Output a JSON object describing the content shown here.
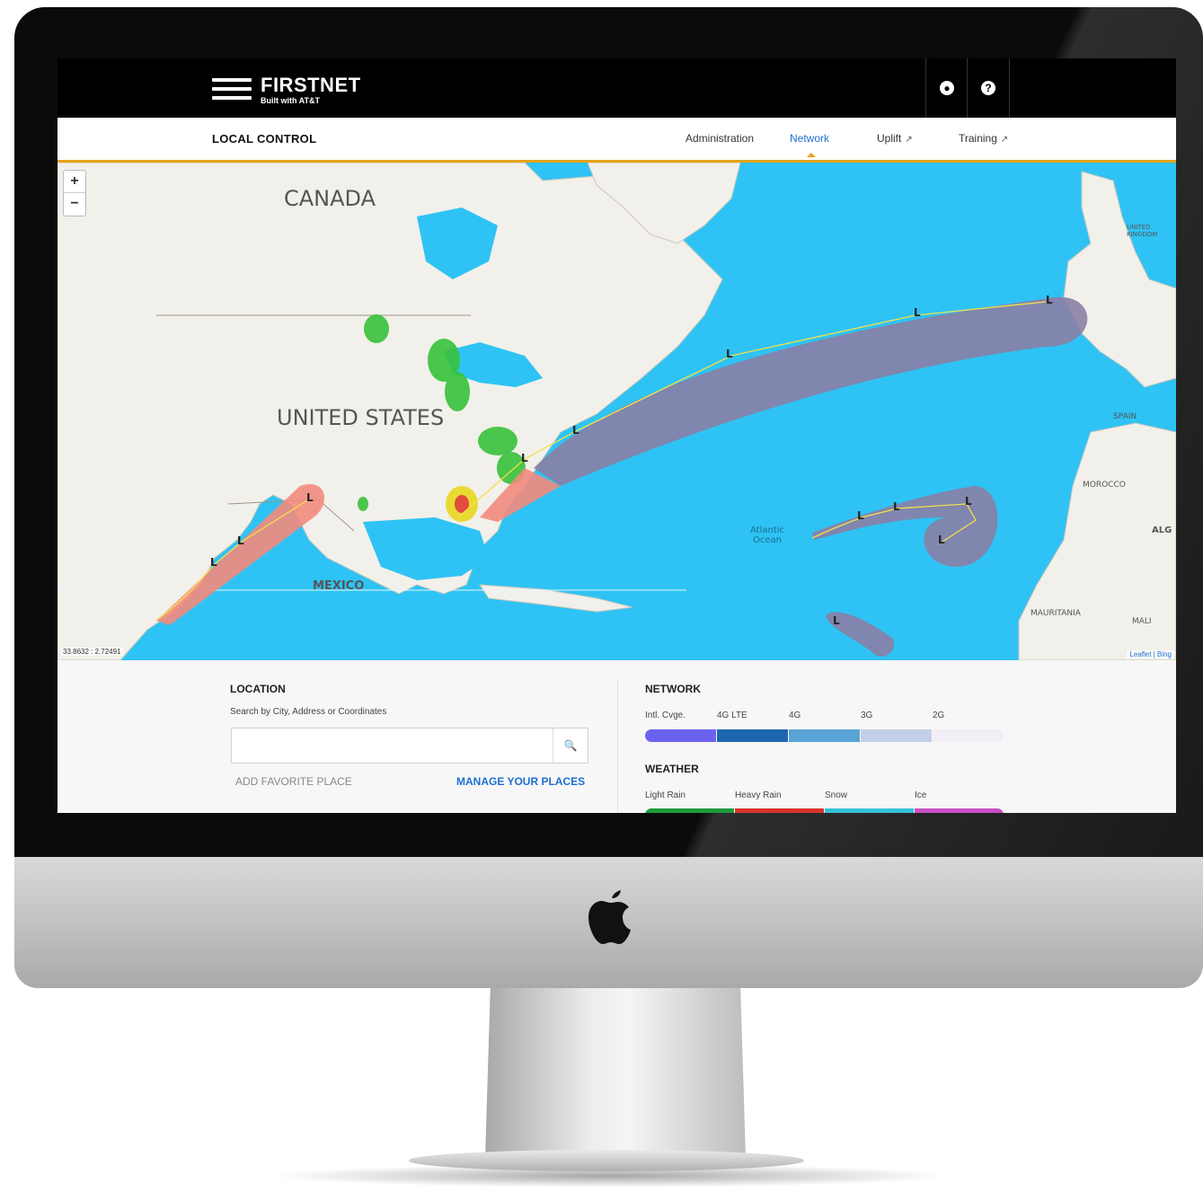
{
  "app": {
    "brand": "FIRSTNET",
    "tagline": "Built with AT&T",
    "page_title": "LOCAL CONTROL"
  },
  "header": {
    "account_icon": "user-icon",
    "help_icon": "help-icon"
  },
  "nav": {
    "tabs": [
      {
        "label": "Administration",
        "active": false
      },
      {
        "label": "Network",
        "active": true
      },
      {
        "label": "Uplift",
        "external": true
      },
      {
        "label": "Training",
        "external": true
      }
    ],
    "external_icon": "external-link-icon"
  },
  "map": {
    "zoom_in": "+",
    "zoom_out": "−",
    "labels": {
      "canada": "CANADA",
      "united_states": "UNITED STATES",
      "mexico": "MEXICO",
      "atlantic": "Atlantic Ocean",
      "morocco": "MOROCCO",
      "mauritania": "MAURITANIA",
      "mali": "MALI",
      "spain": "SPAIN",
      "alg": "ALG",
      "uk": "UNITED KINGDOM"
    },
    "coords": "33.8632 : 2.72491",
    "attribution": "Leaflet | Bing",
    "storm_marker": "L"
  },
  "location": {
    "heading": "LOCATION",
    "hint": "Search by City, Address or Coordinates",
    "search_value": "",
    "search_placeholder": "",
    "search_icon": "search-icon",
    "add_favorite": "ADD FAVORITE PLACE",
    "manage_places": "MANAGE YOUR PLACES"
  },
  "network_legend": {
    "heading": "NETWORK",
    "items": [
      {
        "label": "Intl. Cvge.",
        "color": "#6b63f0"
      },
      {
        "label": "4G LTE",
        "color": "#1f66b0"
      },
      {
        "label": "4G",
        "color": "#5aa3d6"
      },
      {
        "label": "3G",
        "color": "#c3cfe8"
      },
      {
        "label": "2G",
        "color": "#f1eef6"
      }
    ]
  },
  "weather_legend": {
    "heading": "WEATHER",
    "items": [
      {
        "label": "Light Rain",
        "color": "#1e9a3c"
      },
      {
        "label": "Heavy Rain",
        "color": "#d8322d"
      },
      {
        "label": "Snow",
        "color": "#36c2d6"
      },
      {
        "label": "Ice",
        "color": "#c94fc4"
      }
    ]
  }
}
